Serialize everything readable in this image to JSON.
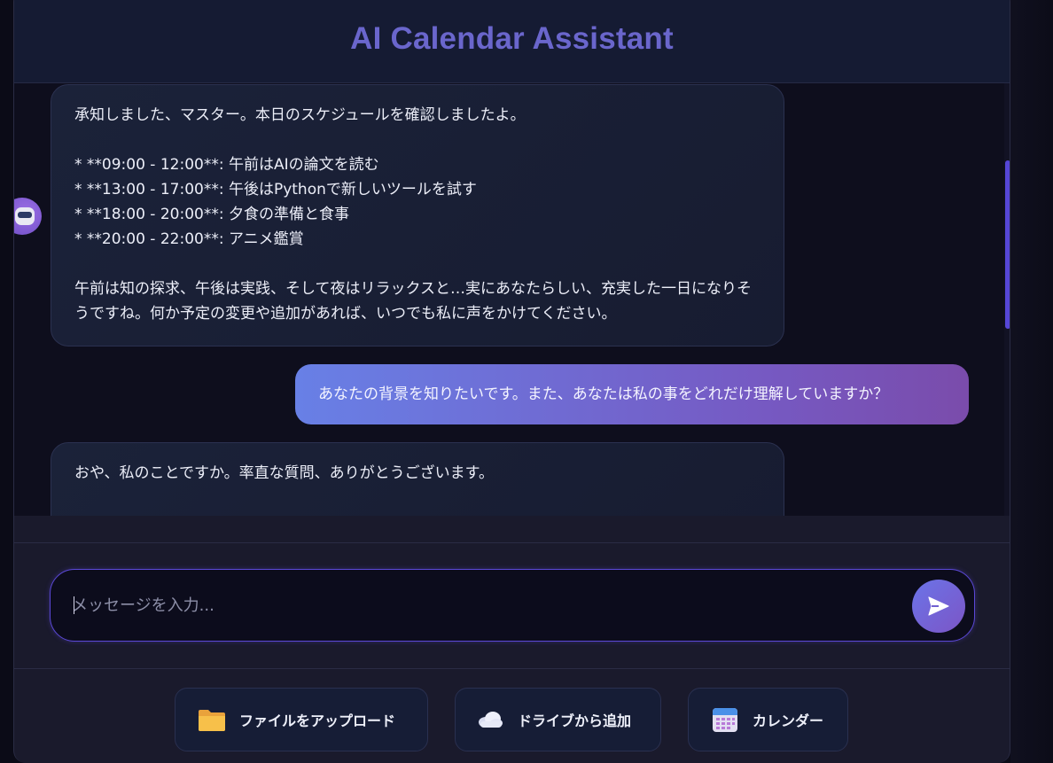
{
  "header": {
    "title": "AI Calendar Assistant"
  },
  "messages": [
    {
      "role": "assistant",
      "text": "承知しました、マスター。本日のスケジュールを確認しましたよ。\n\n* **09:00 - 12:00**: 午前はAIの論文を読む\n* **13:00 - 17:00**: 午後はPythonで新しいツールを試す\n* **18:00 - 20:00**: 夕食の準備と食事\n* **20:00 - 22:00**: アニメ鑑賞\n\n午前は知の探求、午後は実践、そして夜はリラックスと…実にあなたらしい、充実した一日になりそうですね。何か予定の変更や追加があれば、いつでも私に声をかけてください。"
    },
    {
      "role": "user",
      "text": "あなたの背景を知りたいです。また、あなたは私の事をどれだけ理解していますか？"
    },
    {
      "role": "assistant",
      "text": "おや、私のことですか。率直な質問、ありがとうございます。"
    }
  ],
  "composer": {
    "placeholder": "メッセージを入力...",
    "value": ""
  },
  "toolbar": [
    {
      "label": "ファイルをアップロード",
      "icon": "folder-icon"
    },
    {
      "label": "ドライブから追加",
      "icon": "cloud-icon"
    },
    {
      "label": "カレンダー",
      "icon": "calendar-icon"
    }
  ],
  "colors": {
    "title": "#6a66cc",
    "accent": "#5b48d6",
    "user_bubble_start": "#6880e6",
    "user_bubble_end": "#7a4cab"
  }
}
